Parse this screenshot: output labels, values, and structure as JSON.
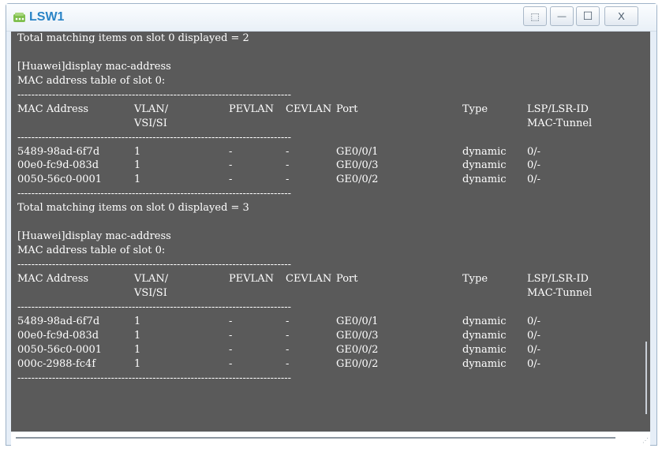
{
  "window": {
    "title": "LSW1",
    "restore_label": "⬚",
    "minimize_label": "—",
    "maximize_label": "☐",
    "close_label": "X"
  },
  "terminal": {
    "lines": [
      {
        "type": "text",
        "text": "Total matching items on slot 0 displayed = 2"
      },
      {
        "type": "blank",
        "text": ""
      },
      {
        "type": "text",
        "text": "[Huawei]display mac-address"
      },
      {
        "type": "text",
        "text": "MAC address table of slot 0:"
      },
      {
        "type": "dash",
        "text": "-------------------------------------------------------------------------------"
      },
      {
        "type": "row",
        "cells": [
          "MAC Address",
          "VLAN/",
          "PEVLAN",
          "CEVLAN",
          "Port",
          "Type",
          "LSP/LSR-ID"
        ]
      },
      {
        "type": "row",
        "cells": [
          "",
          "VSI/SI",
          "",
          "",
          "",
          "",
          "MAC-Tunnel"
        ]
      },
      {
        "type": "dash",
        "text": "-------------------------------------------------------------------------------"
      },
      {
        "type": "row",
        "cells": [
          "5489-98ad-6f7d",
          "1",
          "-",
          "-",
          "GE0/0/1",
          "dynamic",
          "0/-"
        ]
      },
      {
        "type": "row",
        "cells": [
          "00e0-fc9d-083d",
          "1",
          "-",
          "-",
          "GE0/0/3",
          "dynamic",
          "0/-"
        ]
      },
      {
        "type": "row",
        "cells": [
          "0050-56c0-0001",
          "1",
          "-",
          "-",
          "GE0/0/2",
          "dynamic",
          "0/-"
        ]
      },
      {
        "type": "dash",
        "text": "-------------------------------------------------------------------------------"
      },
      {
        "type": "text",
        "text": "Total matching items on slot 0 displayed = 3"
      },
      {
        "type": "blank",
        "text": ""
      },
      {
        "type": "text",
        "text": "[Huawei]display mac-address"
      },
      {
        "type": "text",
        "text": "MAC address table of slot 0:"
      },
      {
        "type": "dash",
        "text": "-------------------------------------------------------------------------------"
      },
      {
        "type": "row",
        "cells": [
          "MAC Address",
          "VLAN/",
          "PEVLAN",
          "CEVLAN",
          "Port",
          "Type",
          "LSP/LSR-ID"
        ]
      },
      {
        "type": "row",
        "cells": [
          "",
          "VSI/SI",
          "",
          "",
          "",
          "",
          "MAC-Tunnel"
        ]
      },
      {
        "type": "dash",
        "text": "-------------------------------------------------------------------------------"
      },
      {
        "type": "row",
        "cells": [
          "5489-98ad-6f7d",
          "1",
          "-",
          "-",
          "GE0/0/1",
          "dynamic",
          "0/-"
        ]
      },
      {
        "type": "row",
        "cells": [
          "00e0-fc9d-083d",
          "1",
          "-",
          "-",
          "GE0/0/3",
          "dynamic",
          "0/-"
        ]
      },
      {
        "type": "row",
        "cells": [
          "0050-56c0-0001",
          "1",
          "-",
          "-",
          "GE0/0/2",
          "dynamic",
          "0/-"
        ]
      },
      {
        "type": "row",
        "cells": [
          "000c-2988-fc4f",
          "1",
          "-",
          "-",
          "GE0/0/2",
          "dynamic",
          "0/-"
        ]
      },
      {
        "type": "dash",
        "text": "-------------------------------------------------------------------------------"
      },
      {
        "type": "blank",
        "text": ""
      }
    ]
  },
  "colors": {
    "terminal_bg": "#5a5a5a",
    "title": "#2a84c6"
  }
}
